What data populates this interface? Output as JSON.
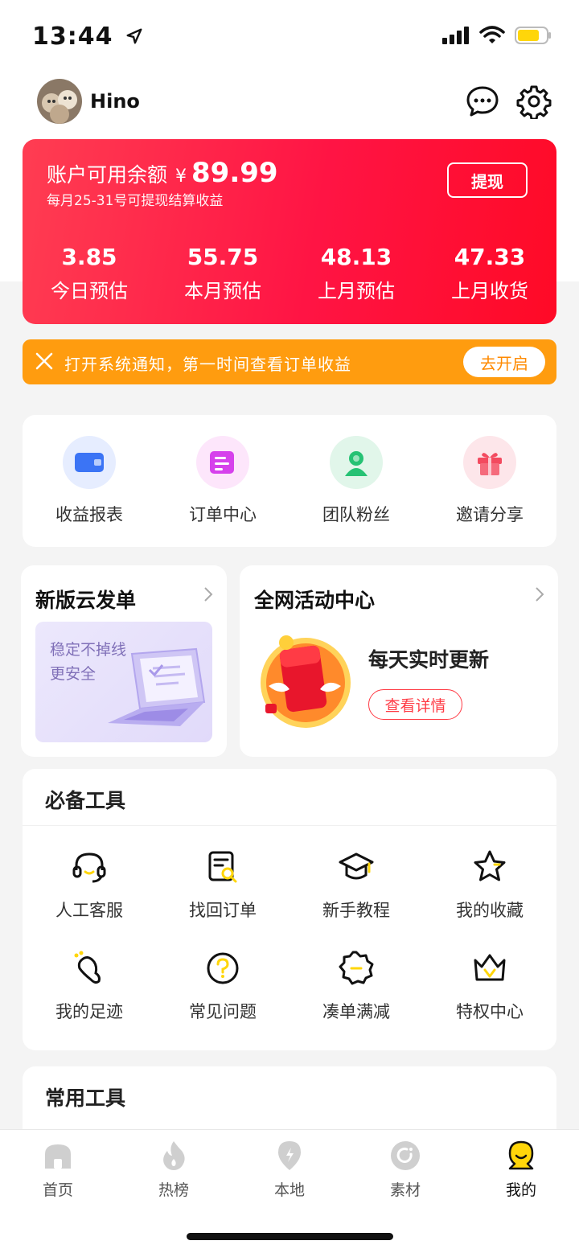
{
  "status_bar": {
    "time": "13:44"
  },
  "header": {
    "username": "Hino"
  },
  "balance": {
    "label": "账户可用余额",
    "currency": "¥",
    "amount": "89.99",
    "note": "每月25-31号可提现结算收益",
    "withdraw_label": "提现",
    "stats": [
      {
        "value": "3.85",
        "label": "今日预估"
      },
      {
        "value": "55.75",
        "label": "本月预估"
      },
      {
        "value": "48.13",
        "label": "上月预估"
      },
      {
        "value": "47.33",
        "label": "上月收货"
      }
    ]
  },
  "notice": {
    "text": "打开系统通知，第一时间查看订单收益",
    "button": "去开启"
  },
  "shortcuts": [
    {
      "label": "收益报表",
      "icon": "wallet-icon"
    },
    {
      "label": "订单中心",
      "icon": "order-icon"
    },
    {
      "label": "团队粉丝",
      "icon": "team-icon"
    },
    {
      "label": "邀请分享",
      "icon": "gift-icon"
    }
  ],
  "cloud": {
    "title": "新版云发单",
    "line1": "稳定不掉线",
    "line2": "更安全"
  },
  "activity": {
    "title": "全网活动中心",
    "daily": "每天实时更新",
    "detail_button": "查看详情"
  },
  "essential_tools": {
    "title": "必备工具",
    "items": [
      {
        "label": "人工客服",
        "icon": "headset-icon"
      },
      {
        "label": "找回订单",
        "icon": "order-search-icon"
      },
      {
        "label": "新手教程",
        "icon": "graduation-cap-icon"
      },
      {
        "label": "我的收藏",
        "icon": "star-icon"
      },
      {
        "label": "我的足迹",
        "icon": "footprint-icon"
      },
      {
        "label": "常见问题",
        "icon": "question-icon"
      },
      {
        "label": "凑单满减",
        "icon": "discount-badge-icon"
      },
      {
        "label": "特权中心",
        "icon": "crown-icon"
      }
    ]
  },
  "common_tools": {
    "title": "常用工具"
  },
  "tabbar": {
    "items": [
      {
        "label": "首页",
        "icon": "home-icon"
      },
      {
        "label": "热榜",
        "icon": "flame-icon"
      },
      {
        "label": "本地",
        "icon": "local-icon"
      },
      {
        "label": "素材",
        "icon": "material-icon"
      },
      {
        "label": "我的",
        "icon": "me-icon"
      }
    ]
  },
  "colors": {
    "brand_red": "#ff1444",
    "notice_orange": "#ff9c0f",
    "accent_yellow": "#ffd60a"
  }
}
